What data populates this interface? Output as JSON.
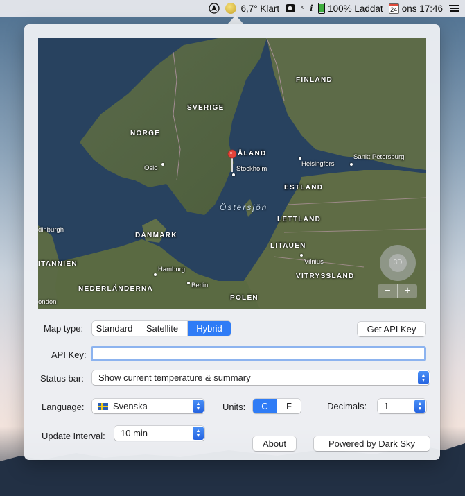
{
  "menubar": {
    "weather_temp": "6,7° Klart",
    "battery": "100% Laddat",
    "calendar_day": "24",
    "clock": "ons 17:46",
    "icons": [
      "navigation-icon",
      "weather-sun-icon",
      "dash-icon",
      "s-icon",
      "info-icon",
      "battery-icon",
      "calendar-icon",
      "menu-list-icon"
    ]
  },
  "map": {
    "countries": [
      "FINLAND",
      "SVERIGE",
      "NORGE",
      "DANMARK",
      "ESTLAND",
      "LETTLAND",
      "LITAUEN",
      "VITRYSSLAND",
      "POLEN",
      "NEDERLÄNDERNA",
      "ITANNIEN"
    ],
    "cities": [
      "Oslo",
      "Stockholm",
      "Helsingfors",
      "Sankt Petersburg",
      "Hamburg",
      "Berlin",
      "Vilnius",
      "dinburgh",
      "ondon"
    ],
    "region": "ÅLAND",
    "sea": "Östersjön",
    "compass_label": "3D",
    "zoom_out": "−",
    "zoom_in": "+"
  },
  "controls": {
    "map_type_label": "Map type:",
    "map_types": [
      "Standard",
      "Satellite",
      "Hybrid"
    ],
    "map_type_selected": "Hybrid",
    "get_api_key": "Get API Key",
    "api_key_label": "API Key:",
    "api_key_value": "",
    "status_bar_label": "Status bar:",
    "status_bar_value": "Show current temperature & summary",
    "language_label": "Language:",
    "language_value": "Svenska",
    "units_label": "Units:",
    "units": [
      "C",
      "F"
    ],
    "units_selected": "C",
    "decimals_label": "Decimals:",
    "decimals_value": "1",
    "update_interval_label": "Update Interval:",
    "update_interval_value": "10 min",
    "about": "About",
    "powered_by": "Powered by Dark Sky"
  },
  "colors": {
    "accent": "#2f7cf6"
  }
}
